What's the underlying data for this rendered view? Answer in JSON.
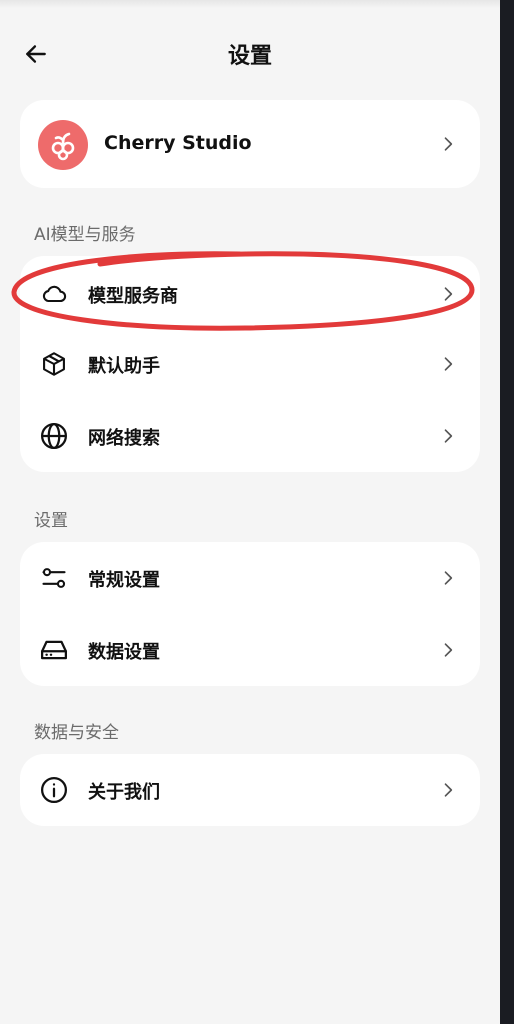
{
  "header": {
    "title": "设置"
  },
  "app_card": {
    "name": "Cherry Studio"
  },
  "sections": [
    {
      "title": "AI模型与服务",
      "items": [
        {
          "label": "模型服务商",
          "icon": "cloud-icon"
        },
        {
          "label": "默认助手",
          "icon": "package-icon"
        },
        {
          "label": "网络搜索",
          "icon": "globe-icon"
        }
      ]
    },
    {
      "title": "设置",
      "items": [
        {
          "label": "常规设置",
          "icon": "sliders-icon"
        },
        {
          "label": "数据设置",
          "icon": "hard-drive-icon"
        }
      ]
    },
    {
      "title": "数据与安全",
      "items": [
        {
          "label": "关于我们",
          "icon": "info-icon"
        }
      ]
    }
  ],
  "annotation": {
    "highlight_color": "#e23a3a",
    "highlighted_item": "模型服务商"
  },
  "colors": {
    "background": "#f5f5f5",
    "card": "#ffffff",
    "brand": "#ee6b6b",
    "section_title": "#6b6b6b"
  }
}
